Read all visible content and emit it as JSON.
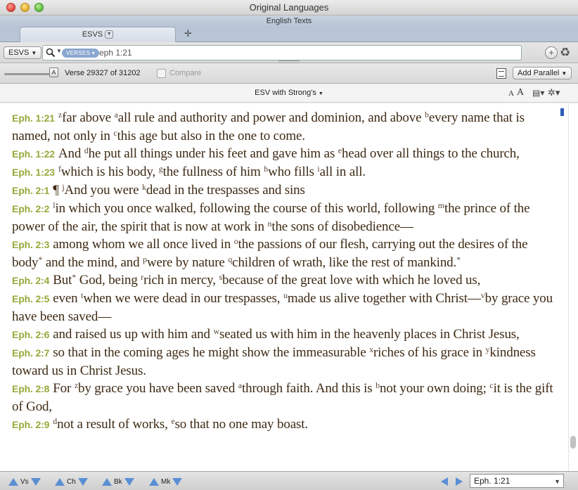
{
  "window": {
    "title": "Original Languages",
    "subtitle": "English Texts"
  },
  "tabs": [
    {
      "label": "ESVS"
    }
  ],
  "toolbar": {
    "version_label": "ESVS",
    "search_scope": "VERSES",
    "search_value": "eph 1:21",
    "add_icon": "plus-circle-icon",
    "recycle_icon": "recycle-icon"
  },
  "status": {
    "slider_thumb_label": "A",
    "verse_position": "Verse 29327 of 31202",
    "compare_label": "Compare",
    "add_parallel_label": "Add Parallel"
  },
  "reader": {
    "version_menu": "ESV with Strong's",
    "font_small_label": "A",
    "font_large_label": "A"
  },
  "colors": {
    "verse_ref": "#94aa3b",
    "text": "#3e2a14",
    "accent_blue": "#5b8fd3",
    "pill": "#8aa7cf"
  },
  "bottom_nav": {
    "verse_label": "Vs",
    "chapter_label": "Ch",
    "book_label": "Bk",
    "mark_label": "Mk",
    "goto_value": "Eph. 1:21"
  },
  "verses": [
    {
      "ref": "Eph. 1:21"
    },
    {
      "ref": "Eph. 1:22"
    },
    {
      "ref": "Eph. 1:23"
    },
    {
      "ref": "Eph. 2:1"
    },
    {
      "ref": "Eph. 2:2"
    },
    {
      "ref": "Eph. 2:3"
    },
    {
      "ref": "Eph. 2:4"
    },
    {
      "ref": "Eph. 2:5"
    },
    {
      "ref": "Eph. 2:6"
    },
    {
      "ref": "Eph. 2:7"
    },
    {
      "ref": "Eph. 2:8"
    },
    {
      "ref": "Eph. 2:9"
    }
  ],
  "verse_text": {
    "v1_21_a": "far above ",
    "v1_21_b": "all rule and authority and power and dominion, and above ",
    "v1_21_c": "every name that is named, not only in ",
    "v1_21_d": "this age but also in the one to come.",
    "v1_22_a": "And ",
    "v1_22_b": "he put all things under his feet and gave him as ",
    "v1_22_c": "head over all things to the church,",
    "v1_23_a": "which is his body, ",
    "v1_23_b": "the fullness of him ",
    "v1_23_c": "who fills ",
    "v1_23_d": "all in all.",
    "v2_1_mark": "¶",
    "v2_1_a": "And you were ",
    "v2_1_b": "dead in the trespasses and sins",
    "v2_2_a": "in which you once walked, following the course of this world, following ",
    "v2_2_b": "the prince of the power of the air, the spirit that is now at work in ",
    "v2_2_c": "the sons of disobedience—",
    "v2_3_a": "among whom we all once lived in ",
    "v2_3_b": "the passions of our flesh, carrying out the desires of the body",
    "v2_3_c": " and the mind, and ",
    "v2_3_d": "were by nature ",
    "v2_3_e": "children of wrath, like the rest of mankind.",
    "v2_4_a": "But",
    "v2_4_b": " God, being ",
    "v2_4_c": "rich in mercy, ",
    "v2_4_d": "because of the great love with which he loved us,",
    "v2_5_a": "even ",
    "v2_5_b": "when we were dead in our trespasses, ",
    "v2_5_c": "made us alive together with Christ—",
    "v2_5_d": "by grace you have been saved—",
    "v2_6_a": "and raised us up with him and ",
    "v2_6_b": "seated us with him in the heavenly places in Christ Jesus,",
    "v2_7_a": "so that in the coming ages he might show the immeasurable ",
    "v2_7_b": "riches of his grace in ",
    "v2_7_c": "kindness toward us in Christ Jesus.",
    "v2_8_a": "For ",
    "v2_8_b": "by grace you have been saved ",
    "v2_8_c": "through faith. And this is ",
    "v2_8_d": "not your own doing; ",
    "v2_8_e": "it is the gift of God,",
    "v2_9_a": "not a result of works, ",
    "v2_9_b": "so that no one may boast."
  },
  "footnotes": {
    "z": "z",
    "a": "a",
    "b": "b",
    "c": "c",
    "d": "d",
    "e": "e",
    "f": "f",
    "g": "g",
    "h": "h",
    "i": "i",
    "j": "j",
    "k": "k",
    "l": "l",
    "m": "m",
    "n": "n",
    "o": "o",
    "p": "p",
    "q": "q",
    "r": "r",
    "s": "s",
    "t": "t",
    "u": "u",
    "v": "v",
    "w": "w",
    "x": "x",
    "y": "y",
    "star": "*"
  }
}
